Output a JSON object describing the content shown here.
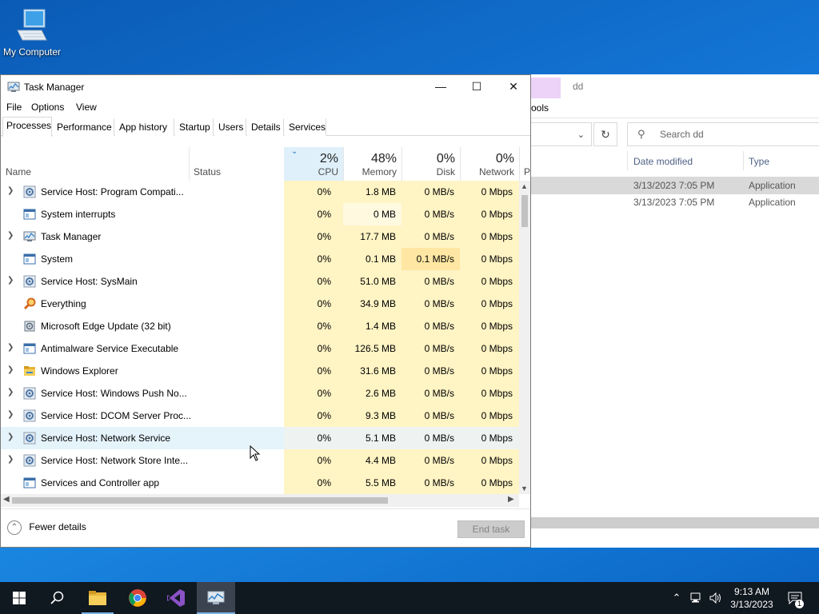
{
  "desktop": {
    "icon_label": "My Computer"
  },
  "explorer": {
    "title_fragment": "dd",
    "ribbon_fragment": "ools",
    "search_placeholder": "Search dd",
    "columns": [
      "Date modified",
      "Type"
    ],
    "rows": [
      {
        "date": "3/13/2023 7:05 PM",
        "type": "Application"
      },
      {
        "date": "3/13/2023 7:05 PM",
        "type": "Application"
      }
    ]
  },
  "task_manager": {
    "title": "Task Manager",
    "menu": [
      "File",
      "Options",
      "View"
    ],
    "tabs": [
      "Processes",
      "Performance",
      "App history",
      "Startup",
      "Users",
      "Details",
      "Services"
    ],
    "header": {
      "name": "Name",
      "status": "Status",
      "cpu_pct": "2%",
      "cpu": "CPU",
      "mem_pct": "48%",
      "mem": "Memory",
      "disk_pct": "0%",
      "disk": "Disk",
      "net_pct": "0%",
      "net": "Network",
      "extra": "P"
    },
    "processes": [
      {
        "name": "Service Host: Program Compati...",
        "icon": "gear-icon",
        "expand": true,
        "cpu": "0%",
        "mem": "1.8 MB",
        "disk": "0 MB/s",
        "net": "0 Mbps"
      },
      {
        "name": "System interrupts",
        "icon": "window-icon",
        "expand": false,
        "cpu": "0%",
        "mem": "0 MB",
        "disk": "0 MB/s",
        "net": "0 Mbps"
      },
      {
        "name": "Task Manager",
        "icon": "task-manager-icon",
        "expand": true,
        "cpu": "0%",
        "mem": "17.7 MB",
        "disk": "0 MB/s",
        "net": "0 Mbps"
      },
      {
        "name": "System",
        "icon": "window-icon",
        "expand": false,
        "cpu": "0%",
        "mem": "0.1 MB",
        "disk": "0.1 MB/s",
        "net": "0 Mbps"
      },
      {
        "name": "Service Host: SysMain",
        "icon": "gear-icon",
        "expand": true,
        "cpu": "0%",
        "mem": "51.0 MB",
        "disk": "0 MB/s",
        "net": "0 Mbps"
      },
      {
        "name": "Everything",
        "icon": "magnifier-icon",
        "expand": false,
        "cpu": "0%",
        "mem": "34.9 MB",
        "disk": "0 MB/s",
        "net": "0 Mbps"
      },
      {
        "name": "Microsoft Edge Update (32 bit)",
        "icon": "installer-icon",
        "expand": false,
        "cpu": "0%",
        "mem": "1.4 MB",
        "disk": "0 MB/s",
        "net": "0 Mbps"
      },
      {
        "name": "Antimalware Service Executable",
        "icon": "window-icon",
        "expand": true,
        "cpu": "0%",
        "mem": "126.5 MB",
        "disk": "0 MB/s",
        "net": "0 Mbps"
      },
      {
        "name": "Windows Explorer",
        "icon": "folder-icon",
        "expand": true,
        "cpu": "0%",
        "mem": "31.6 MB",
        "disk": "0 MB/s",
        "net": "0 Mbps"
      },
      {
        "name": "Service Host: Windows Push No...",
        "icon": "gear-icon",
        "expand": true,
        "cpu": "0%",
        "mem": "2.6 MB",
        "disk": "0 MB/s",
        "net": "0 Mbps"
      },
      {
        "name": "Service Host: DCOM Server Proc...",
        "icon": "gear-icon",
        "expand": true,
        "cpu": "0%",
        "mem": "9.3 MB",
        "disk": "0 MB/s",
        "net": "0 Mbps"
      },
      {
        "name": "Service Host: Network Service",
        "icon": "gear-icon",
        "expand": true,
        "cpu": "0%",
        "mem": "5.1 MB",
        "disk": "0 MB/s",
        "net": "0 Mbps"
      },
      {
        "name": "Service Host: Network Store Inte...",
        "icon": "gear-icon",
        "expand": true,
        "cpu": "0%",
        "mem": "4.4 MB",
        "disk": "0 MB/s",
        "net": "0 Mbps"
      },
      {
        "name": "Services and Controller app",
        "icon": "window-icon",
        "expand": false,
        "cpu": "0%",
        "mem": "5.5 MB",
        "disk": "0 MB/s",
        "net": "0 Mbps"
      }
    ],
    "hovered_row": 11,
    "footer": {
      "fewer_details": "Fewer details",
      "end_task": "End task"
    }
  },
  "taskbar": {
    "apps": [
      "start-icon",
      "search-icon",
      "file-explorer-icon",
      "chrome-icon",
      "visual-studio-icon",
      "task-manager-icon"
    ],
    "time": "9:13 AM",
    "date": "3/13/2023",
    "notification_count": "1"
  }
}
